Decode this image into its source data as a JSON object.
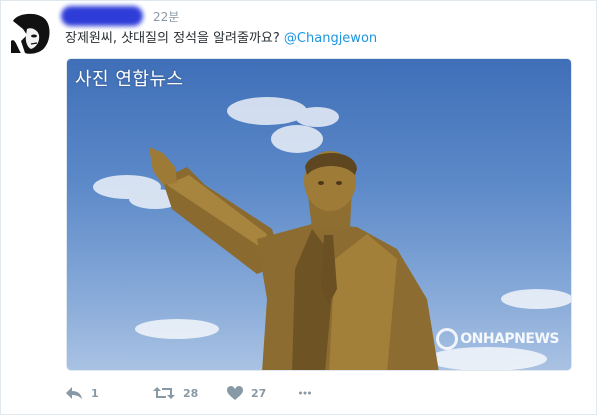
{
  "tweet": {
    "time": "22분",
    "text": "장제원씨, 샷대질의 정석을 알려줄까요? ",
    "mention": "@Changjewon",
    "media": {
      "caption": "사진 연합뉴스",
      "watermark": "ONHAPNEWS"
    },
    "actions": {
      "reply_count": "1",
      "retweet_count": "28",
      "like_count": "27"
    }
  },
  "colors": {
    "accent": "#1b95e0",
    "icon": "#8899a6",
    "text": "#292f33"
  }
}
